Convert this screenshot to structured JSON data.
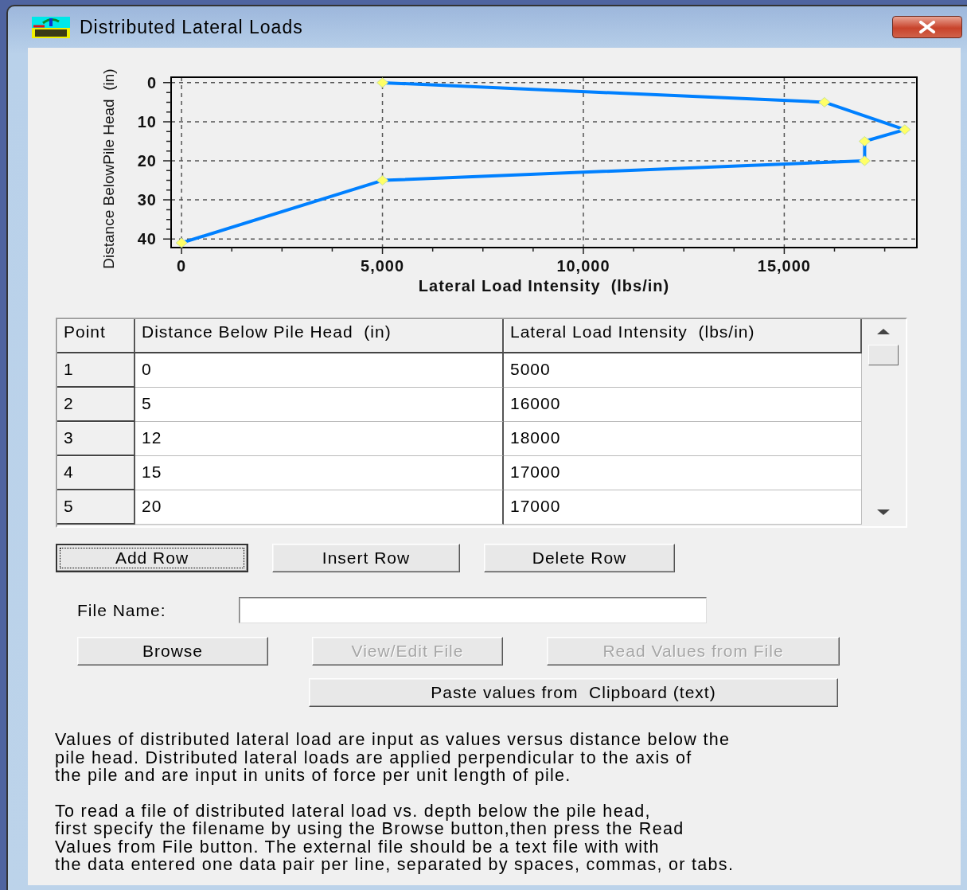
{
  "window": {
    "title": "Distributed Lateral Loads"
  },
  "chart": {
    "chart_data": {
      "type": "line",
      "xlabel": "Lateral Load Intensity  (lbs/in)",
      "ylabel": "Distance BelowPile Head  (in)",
      "x": [
        5000,
        16000,
        18000,
        17000,
        17000,
        5000,
        0
      ],
      "series": [
        {
          "color": "#0080ff",
          "marker": "diamond",
          "values": [
            0,
            5,
            12,
            15,
            20,
            25,
            41
          ]
        }
      ],
      "grid": true,
      "xlim": [
        -260,
        18300
      ],
      "ylim": [
        42.2,
        -1.4
      ],
      "xticks": [
        {
          "value": 0,
          "label": "0"
        },
        {
          "value": 5000,
          "label": "5,000"
        },
        {
          "value": 10000,
          "label": "10,000"
        },
        {
          "value": 15000,
          "label": "15,000"
        }
      ],
      "yticks": [
        0,
        10,
        20,
        30,
        40
      ]
    }
  },
  "table": {
    "columns": [
      "Point",
      "Distance Below Pile Head  (in)",
      "Lateral Load Intensity  (lbs/in)"
    ],
    "rows": [
      [
        "1",
        "0",
        "5000"
      ],
      [
        "2",
        "5",
        "16000"
      ],
      [
        "3",
        "12",
        "18000"
      ],
      [
        "4",
        "15",
        "17000"
      ],
      [
        "5",
        "20",
        "17000"
      ]
    ]
  },
  "row_buttons": [
    {
      "label": "Add Row",
      "focused": true,
      "disabled": false
    },
    {
      "label": "Insert Row",
      "focused": false,
      "disabled": false
    },
    {
      "label": "Delete Row",
      "focused": false,
      "disabled": false
    }
  ],
  "file_name": {
    "label": "File Name:"
  },
  "file_buttons": [
    {
      "label": "Browse",
      "disabled": false
    },
    {
      "label": "View/Edit File",
      "disabled": true
    },
    {
      "label": "Read Values from File",
      "disabled": true
    }
  ],
  "paste_button": {
    "label": "Paste values from  Clipboard (text)",
    "disabled": false
  },
  "notes": [
    {
      "lines": [
        "Values of distributed lateral load are input as values versus distance below the",
        "pile head. Distributed lateral loads are applied perpendicular to the axis of",
        "the pile and are input in units of force per unit length of pile."
      ]
    },
    {
      "lines": [
        "To read a file of distributed lateral load vs. depth below the pile head,",
        "first specify the filename by using the Browse button,then press the Read",
        "Values from File button. The external file should be a text file with with",
        "the data entered one data pair per line, separated by spaces, commas, or tabs."
      ]
    }
  ]
}
